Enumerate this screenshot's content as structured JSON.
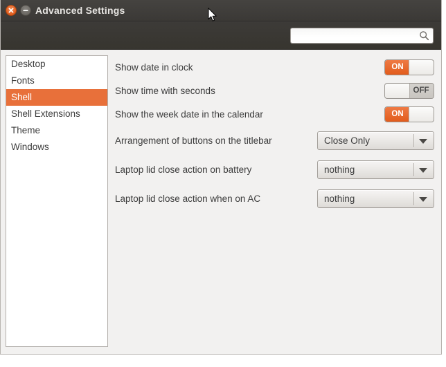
{
  "window": {
    "title": "Advanced Settings",
    "close_icon": "close-icon",
    "minimize_icon": "minimize-icon"
  },
  "search": {
    "value": "",
    "placeholder": "",
    "icon": "search-icon"
  },
  "sidebar": {
    "items": [
      {
        "label": "Desktop",
        "selected": false
      },
      {
        "label": "Fonts",
        "selected": false
      },
      {
        "label": "Shell",
        "selected": true
      },
      {
        "label": "Shell Extensions",
        "selected": false
      },
      {
        "label": "Theme",
        "selected": false
      },
      {
        "label": "Windows",
        "selected": false
      }
    ]
  },
  "settings": {
    "rows": [
      {
        "label": "Show date in clock",
        "type": "toggle",
        "state": "ON"
      },
      {
        "label": "Show time with seconds",
        "type": "toggle",
        "state": "OFF"
      },
      {
        "label": "Show the week date in the calendar",
        "type": "toggle",
        "state": "ON"
      },
      {
        "label": "Arrangement of buttons on the titlebar",
        "type": "combo",
        "value": "Close Only"
      },
      {
        "label": "Laptop lid close action on battery",
        "type": "combo",
        "value": "nothing"
      },
      {
        "label": "Laptop lid close action when on AC",
        "type": "combo",
        "value": "nothing"
      }
    ]
  },
  "colors": {
    "accent_orange": "#e8703a",
    "titlebar_dark": "#3b3936",
    "window_bg": "#f2f1f0",
    "list_bg": "#ffffff"
  }
}
